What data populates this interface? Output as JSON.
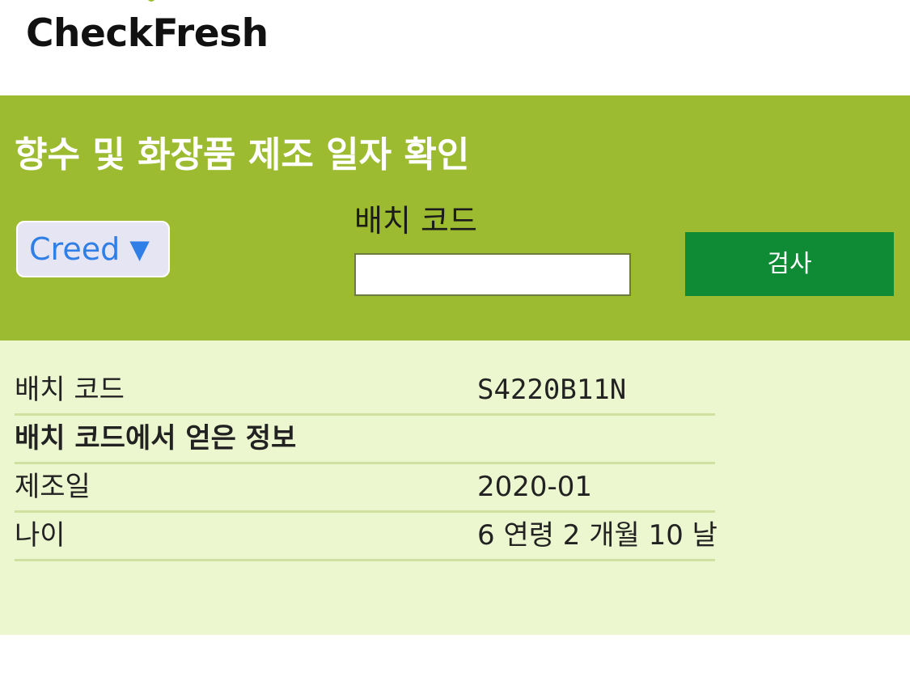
{
  "app": {
    "logo_text": "CheckFresh"
  },
  "search": {
    "title": "향수 및 화장품 제조 일자 확인",
    "brand_selected": "Creed",
    "brand_arrow": "▼",
    "batch_label": "배치 코드",
    "batch_input_value": "",
    "check_button_label": "검사"
  },
  "results": {
    "rows": [
      {
        "label": "배치 코드",
        "value": "S4220B11N"
      },
      {
        "label": "배치 코드에서 얻은 정보",
        "value": ""
      },
      {
        "label": "제조일",
        "value": "2020-01"
      },
      {
        "label": "나이",
        "value": "6 연령 2 개월 10 날"
      }
    ]
  },
  "colors": {
    "panel_green": "#9cbb31",
    "button_green": "#0f8a35",
    "results_bg": "#edf7cf",
    "select_text_blue": "#2f7fe6"
  }
}
